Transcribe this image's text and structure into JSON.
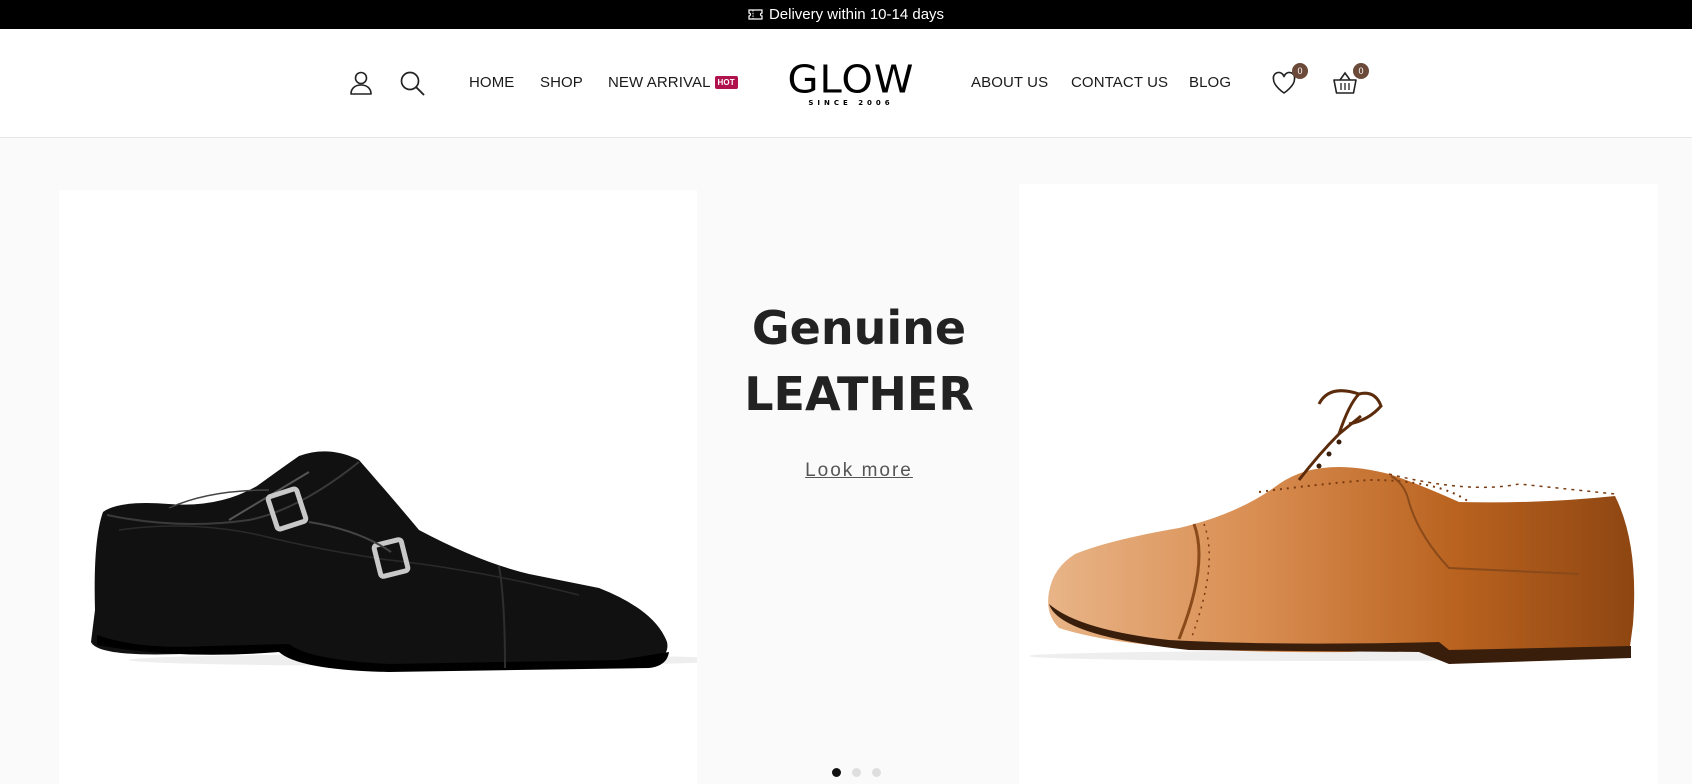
{
  "announcement": {
    "icon": "ticket-icon",
    "text": "Delivery within 10-14 days"
  },
  "header": {
    "nav_left": [
      {
        "label": "HOME"
      },
      {
        "label": "SHOP"
      },
      {
        "label": "NEW ARRIVAL",
        "badge": "HOT"
      }
    ],
    "logo": {
      "word": "GLOW",
      "tagline": "SINCE 2006"
    },
    "nav_right": [
      {
        "label": "ABOUT US"
      },
      {
        "label": "CONTACT US"
      },
      {
        "label": "BLOG"
      }
    ],
    "icons": {
      "account": "user-icon",
      "search": "search-icon",
      "wishlist": "heart-icon",
      "cart": "basket-icon"
    },
    "wishlist_count": "0",
    "cart_count": "0"
  },
  "hero": {
    "title_line1": "Genuine",
    "title_line2": "LEATHER",
    "cta": "Look more",
    "slides_total": 3,
    "active_slide": 1
  },
  "colors": {
    "topbar_bg": "#000000",
    "hot_badge": "#b0124e",
    "count_badge": "#6b4a3a",
    "hero_bg": "#fafafa"
  }
}
